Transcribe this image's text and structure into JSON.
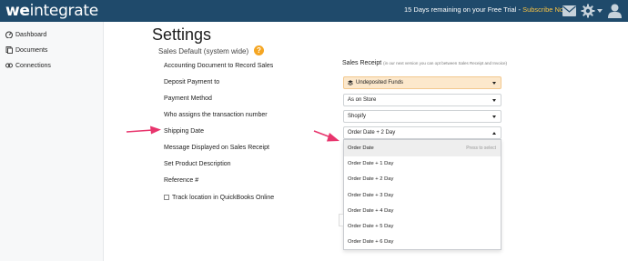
{
  "header": {
    "logo_bold": "we",
    "logo_light": "integrate",
    "trial_text": "15 Days remaining on your Free Trial - ",
    "trial_link": "Subscribe Now",
    "icons": [
      "mail-icon",
      "gear-icon",
      "user-icon"
    ]
  },
  "sidebar": {
    "items": [
      {
        "label": "Dashboard",
        "icon": "dashboard-icon"
      },
      {
        "label": "Documents",
        "icon": "documents-icon"
      },
      {
        "label": "Connections",
        "icon": "connections-icon"
      }
    ]
  },
  "page": {
    "title": "Settings",
    "section": "Sales Default (system wide)",
    "help": "?",
    "rows": [
      "Accounting Document to Record Sales",
      "Deposit Payment to",
      "Payment Method",
      "Who assigns the transaction number",
      "Shipping Date",
      "Message Displayed on Sales Receipt",
      "Set Product Description",
      "Reference #"
    ],
    "track_label": "Track location in QuickBooks Online",
    "track_checked": false
  },
  "sales_receipt": {
    "label": "Sales Receipt",
    "note": "(in our next version you can opt between Sales Receipt and Invoice)",
    "selects": [
      {
        "value": "Undeposited Funds",
        "icon": "layers-icon"
      },
      {
        "value": "As on Store"
      },
      {
        "value": "Shopify"
      },
      {
        "value": "Order Date + 2 Day",
        "open": true
      }
    ],
    "dropdown": {
      "hint": "Press to select",
      "options": [
        "Order Date",
        "Order Date + 1 Day",
        "Order Date + 2 Day",
        "Order Date + 3 Day",
        "Order Date + 4 Day",
        "Order Date + 5 Day",
        "Order Date + 6 Day"
      ],
      "highlighted": "Order Date"
    }
  },
  "colors": {
    "topbar": "#1f4a6b",
    "accent_link": "#f7c244",
    "help_badge": "#f5a623",
    "arrow": "#e8356d",
    "warning_select": "#fce8cc"
  }
}
